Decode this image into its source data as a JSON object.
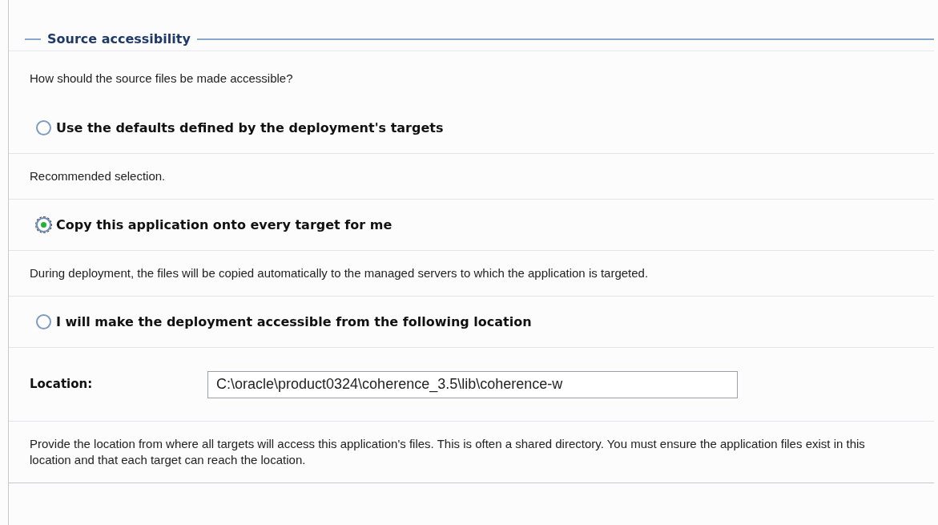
{
  "section": {
    "title": "Source accessibility"
  },
  "prompt": "How should the source files be made accessible?",
  "items": [
    {
      "kind": "radio",
      "label": "Use the defaults defined by the deployment's targets",
      "selected": false
    },
    {
      "kind": "note",
      "text": "Recommended selection."
    },
    {
      "kind": "radio",
      "label": "Copy this application onto every target for me",
      "selected": true
    },
    {
      "kind": "note",
      "text": "During deployment, the files will be copied automatically to the managed servers to which the application is targeted."
    },
    {
      "kind": "radio",
      "label": "I will make the deployment accessible from the following location",
      "selected": false
    },
    {
      "kind": "field",
      "label": "Location:",
      "value": "C:\\oracle\\product0324\\coherence_3.5\\lib\\coherence-w"
    },
    {
      "kind": "note",
      "text": "Provide the location from where all targets will access this application's files. This is often a shared directory. You must ensure the application files exist in this location and that each target can reach the location."
    }
  ]
}
